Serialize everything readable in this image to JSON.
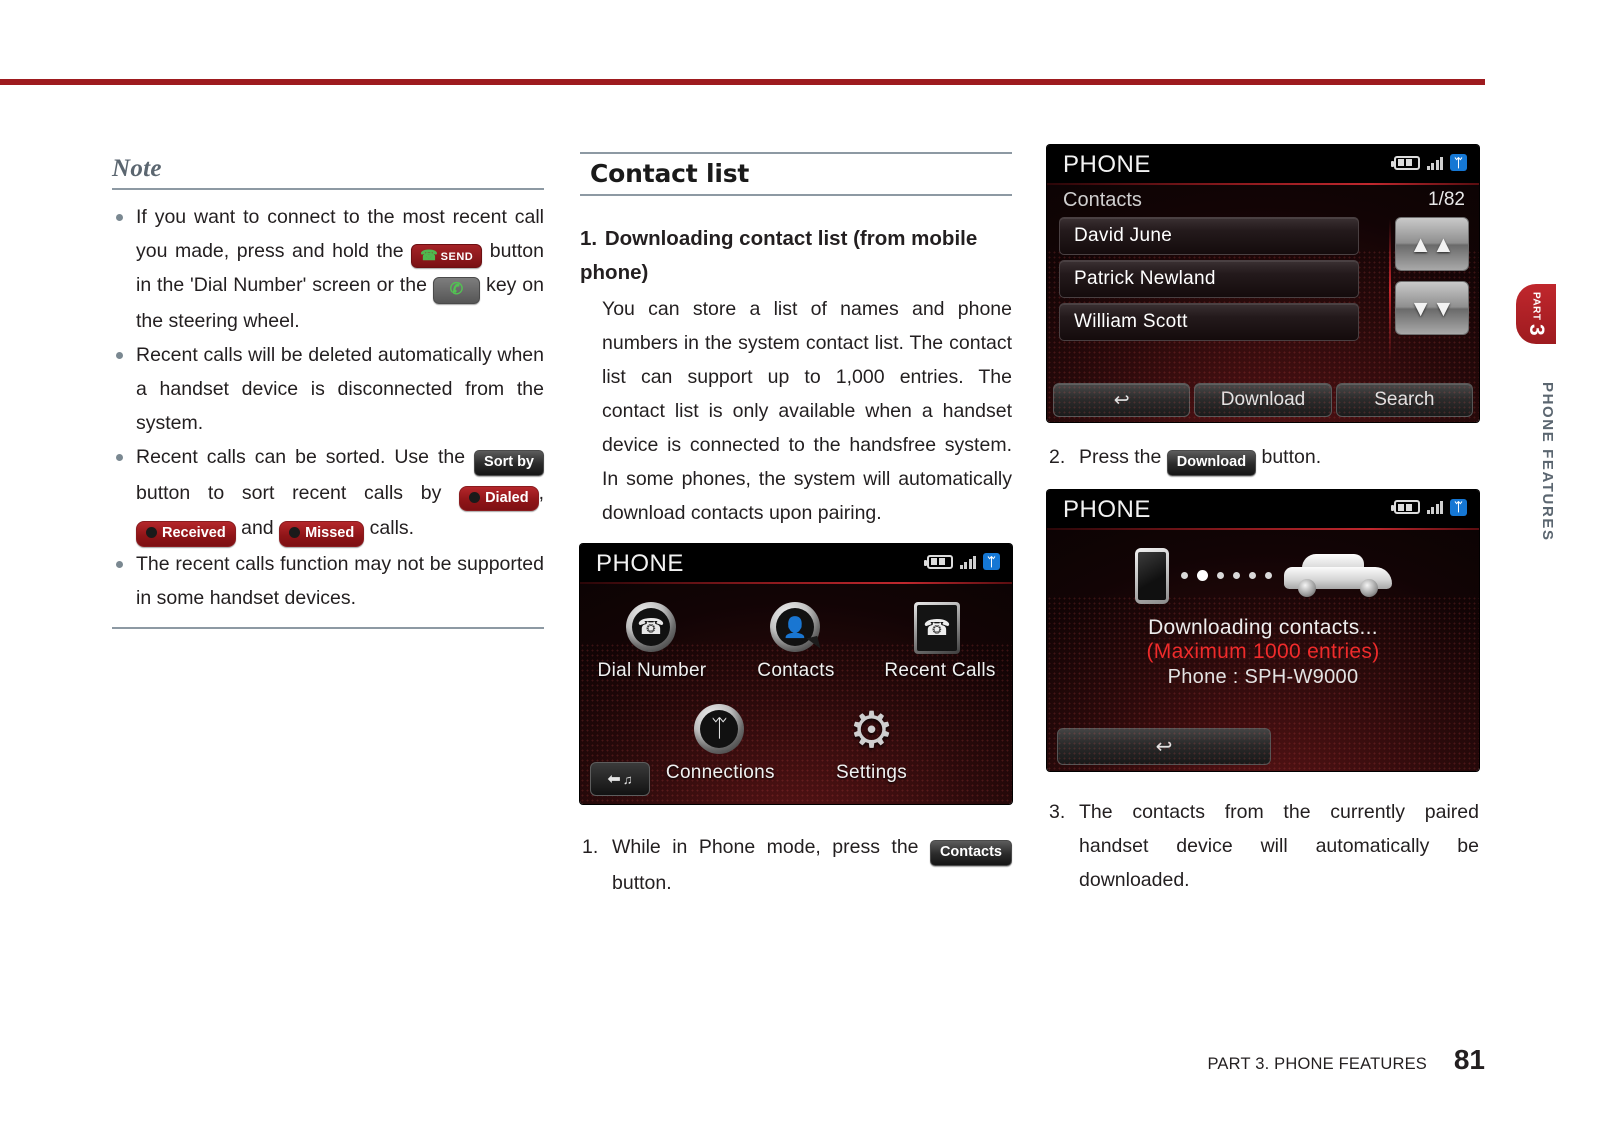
{
  "document": {
    "page_number": "81",
    "footer_text": "PART 3. PHONE FEATURES",
    "side_tab": {
      "part_label": "PART",
      "part_number": "3",
      "section_label": "PHONE FEATURES"
    }
  },
  "note": {
    "title": "Note",
    "items": [
      {
        "parts": [
          {
            "type": "text",
            "value": "If you want to connect to the most recent call you made, press and hold the "
          },
          {
            "type": "chip-send",
            "value": "SEND",
            "hs": "✆"
          },
          {
            "type": "text",
            "value": " button in the 'Dial Number' screen or the "
          },
          {
            "type": "chip-grey",
            "value": "✆"
          },
          {
            "type": "text",
            "value": " key on the steering wheel."
          }
        ]
      },
      {
        "parts": [
          {
            "type": "text",
            "value": "Recent calls will be deleted automatically when a handset device is disconnected from the system."
          }
        ]
      },
      {
        "parts": [
          {
            "type": "text",
            "value": "Recent calls can be sorted. Use the "
          },
          {
            "type": "chip-dark",
            "value": "Sort by"
          },
          {
            "type": "text",
            "value": " button to sort recent calls by "
          },
          {
            "type": "chip-red",
            "value": "Dialed"
          },
          {
            "type": "text",
            "value": ", "
          },
          {
            "type": "chip-red",
            "value": "Received"
          },
          {
            "type": "text",
            "value": " and "
          },
          {
            "type": "chip-red",
            "value": "Missed"
          },
          {
            "type": "text",
            "value": " calls."
          }
        ]
      },
      {
        "parts": [
          {
            "type": "text",
            "value": "The recent calls function may not be supported in some handset devices."
          }
        ]
      }
    ]
  },
  "section": {
    "title": "Contact list",
    "subsection": {
      "number": "1.",
      "heading": "Downloading contact list (from mobile phone)",
      "body": "You can store a list of names and phone numbers in the system contact list. The contact list can support up to 1,000 entries. The contact list is only available when a handset device is connected to the handsfree system. In some phones, the system will automatically download contacts upon pairing."
    }
  },
  "steps": {
    "step1": {
      "marker": "1.",
      "before": "While in Phone mode, press the ",
      "chip": "Contacts",
      "after": " button."
    },
    "step2": {
      "marker": "2.",
      "before": "Press the ",
      "chip": "Download",
      "after": " button."
    },
    "step3": {
      "marker": "3.",
      "text": "The contacts from the currently paired handset device will automatically be downloaded."
    }
  },
  "screenshots": {
    "phone_menu": {
      "title": "PHONE",
      "status_icons": [
        "battery-icon",
        "signal-icon",
        "bluetooth-icon"
      ],
      "items_row1": [
        {
          "label": "Dial Number",
          "icon": "phone-handset-icon"
        },
        {
          "label": "Contacts",
          "icon": "contact-person-bubble-icon"
        },
        {
          "label": "Recent Calls",
          "icon": "call-log-sheet-icon"
        }
      ],
      "items_row2": [
        {
          "label": "Connections",
          "icon": "bluetooth-circle-icon"
        },
        {
          "label": "Settings",
          "icon": "gear-icon"
        }
      ],
      "back_button": "back-media-icon"
    },
    "contacts_list": {
      "title": "PHONE",
      "subtitle": "Contacts",
      "counter": "1/82",
      "rows": [
        "David June",
        "Patrick Newland",
        "William Scott"
      ],
      "scroll_up": "scroll-up-double-arrow",
      "scroll_down": "scroll-down-double-arrow",
      "buttons": [
        {
          "label": "↩",
          "name": "back-button"
        },
        {
          "label": "Download",
          "name": "download-button"
        },
        {
          "label": "Search",
          "name": "search-button"
        }
      ]
    },
    "downloading": {
      "title": "PHONE",
      "line1": "Downloading contacts...",
      "line2": "(Maximum 1000 entries)",
      "line3": "Phone : SPH-W9000",
      "back_button": "↩"
    }
  },
  "colors": {
    "accent_red": "#9e1b1f",
    "rule_grey": "#8d99a3",
    "note_title": "#5b6670",
    "screen_red_text": "#ef2b2b"
  }
}
